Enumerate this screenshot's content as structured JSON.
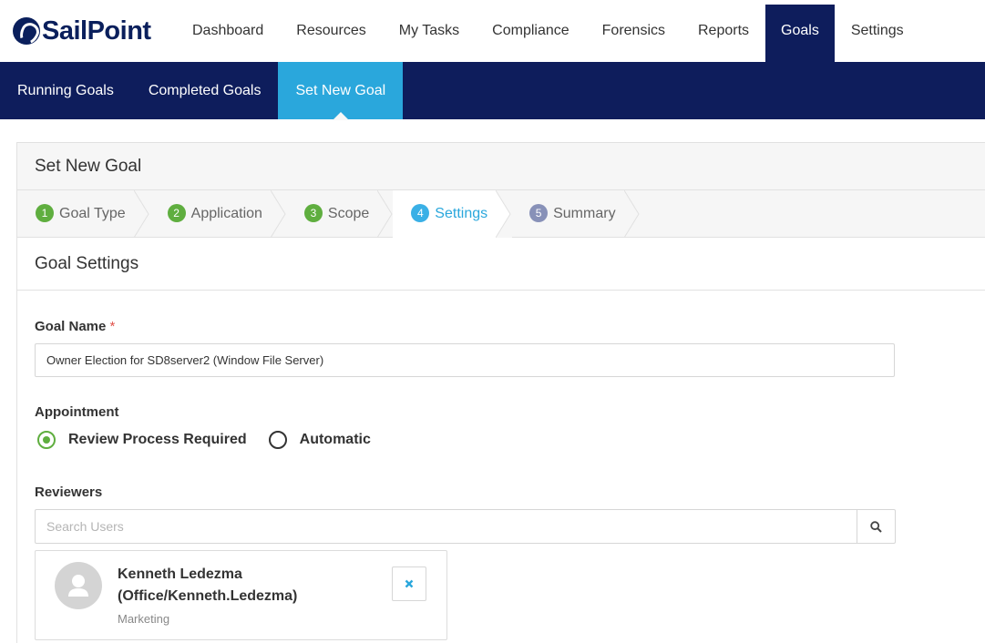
{
  "brand": {
    "name": "SailPoint"
  },
  "topnav": {
    "items": [
      {
        "label": "Dashboard"
      },
      {
        "label": "Resources"
      },
      {
        "label": "My Tasks"
      },
      {
        "label": "Compliance"
      },
      {
        "label": "Forensics"
      },
      {
        "label": "Reports"
      },
      {
        "label": "Goals",
        "active": true
      },
      {
        "label": "Settings"
      }
    ]
  },
  "subnav": {
    "items": [
      {
        "label": "Running Goals"
      },
      {
        "label": "Completed Goals"
      },
      {
        "label": "Set New Goal",
        "active": true
      }
    ]
  },
  "card": {
    "title": "Set New Goal"
  },
  "wizard": {
    "steps": [
      {
        "num": "1",
        "label": "Goal Type",
        "state": "done"
      },
      {
        "num": "2",
        "label": "Application",
        "state": "done"
      },
      {
        "num": "3",
        "label": "Scope",
        "state": "done"
      },
      {
        "num": "4",
        "label": "Settings",
        "state": "current"
      },
      {
        "num": "5",
        "label": "Summary",
        "state": "pending"
      }
    ]
  },
  "section": {
    "title": "Goal Settings"
  },
  "form": {
    "goal_name_label": "Goal Name",
    "required_mark": "*",
    "goal_name_value": "Owner Election for SD8server2 (Window File Server)",
    "appointment_label": "Appointment",
    "appointment_options": [
      {
        "label": "Review Process Required",
        "checked": true
      },
      {
        "label": "Automatic",
        "checked": false
      }
    ],
    "reviewers_label": "Reviewers",
    "search_placeholder": "Search Users"
  },
  "reviewers": [
    {
      "name": "Kenneth Ledezma",
      "account": "(Office/Kenneth.Ledezma)",
      "department": "Marketing"
    }
  ],
  "colors": {
    "brand_navy": "#0e1d5c",
    "accent_blue": "#2aa7dc",
    "step_done_green": "#5fae3f",
    "step_pending": "#8891b8",
    "required_red": "#e0514a"
  }
}
